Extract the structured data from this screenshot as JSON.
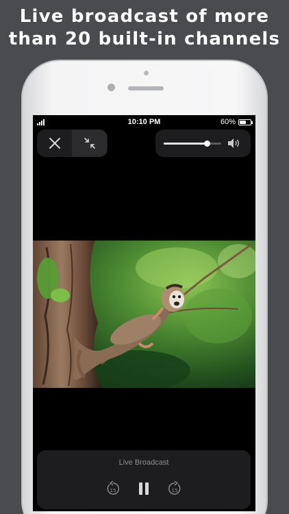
{
  "headline": {
    "line1": "Live broadcast of more",
    "line2": "than 20 built-in channels"
  },
  "status_bar": {
    "time": "10:10 PM",
    "battery_percent": "60%",
    "battery_level": 0.6
  },
  "player": {
    "close_icon": "close-icon",
    "minimize_icon": "exit-fullscreen-icon",
    "volume_level": 0.75,
    "volume_icon": "speaker-volume-icon",
    "now_playing": "Live Broadcast",
    "skip_back_label": "15",
    "skip_forward_label": "15",
    "pause_icon": "pause-icon"
  },
  "video": {
    "subject": "squirrel-monkey-on-branch"
  },
  "colors": {
    "background": "#4a4b4f",
    "panel": "#1d1d1f",
    "screen": "#000000",
    "muted_text": "#8e8e93"
  }
}
